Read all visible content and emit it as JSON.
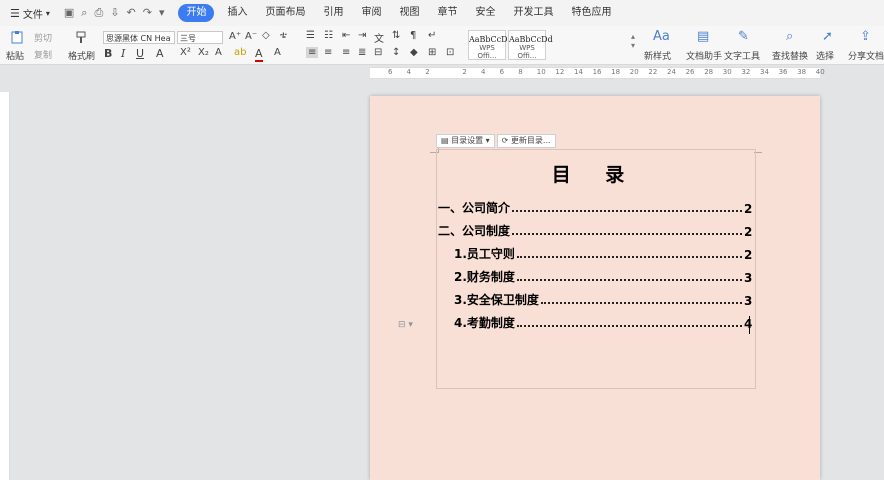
{
  "menubar": {
    "file_label": "文件",
    "tabs": [
      {
        "label": "开始",
        "active": true
      },
      {
        "label": "插入"
      },
      {
        "label": "页面布局"
      },
      {
        "label": "引用"
      },
      {
        "label": "审阅"
      },
      {
        "label": "视图"
      },
      {
        "label": "章节"
      },
      {
        "label": "安全"
      },
      {
        "label": "开发工具"
      },
      {
        "label": "特色应用"
      }
    ]
  },
  "ribbon": {
    "paste_label": "粘贴",
    "cut_label": "剪切",
    "copy_label": "复制",
    "format_painter_label": "格式刷",
    "font_name": "思源黑体 CN Hea",
    "font_size": "三号",
    "style_preview_1": "AaBbCcDd",
    "style_name_1": "WPS Offi...",
    "style_preview_2": "AaBbCcDd",
    "style_name_2": "WPS Offi...",
    "new_style_label": "新样式",
    "doc_assistant_label": "文档助手",
    "text_tools_label": "文字工具",
    "find_replace_label": "查找替换",
    "select_label": "选择",
    "share_label": "分享文档"
  },
  "ruler": {
    "h_numbers": [
      "6",
      "4",
      "2",
      "",
      "2",
      "4",
      "6",
      "8",
      "10",
      "12",
      "14",
      "16",
      "18",
      "20",
      "22",
      "24",
      "26",
      "28",
      "30",
      "32",
      "34",
      "36",
      "38",
      "40"
    ]
  },
  "toc_toolbar": {
    "settings_label": "目录设置",
    "update_label": "更新目录..."
  },
  "document": {
    "title": "目 录",
    "entries": [
      {
        "label": "一、公司简介",
        "page": "2",
        "level": 1
      },
      {
        "label": "二、公司制度",
        "page": "2",
        "level": 1
      },
      {
        "label": "1.员工守则",
        "page": "2",
        "level": 2
      },
      {
        "label": "2.财务制度",
        "page": "3",
        "level": 2
      },
      {
        "label": "3.安全保卫制度",
        "page": "3",
        "level": 2
      },
      {
        "label": "4.考勤制度",
        "page": "4",
        "level": 2
      }
    ]
  },
  "colors": {
    "accent": "#3c7bf0",
    "page_bg": "#f9e0d6",
    "workspace": "#e3e4e6"
  }
}
